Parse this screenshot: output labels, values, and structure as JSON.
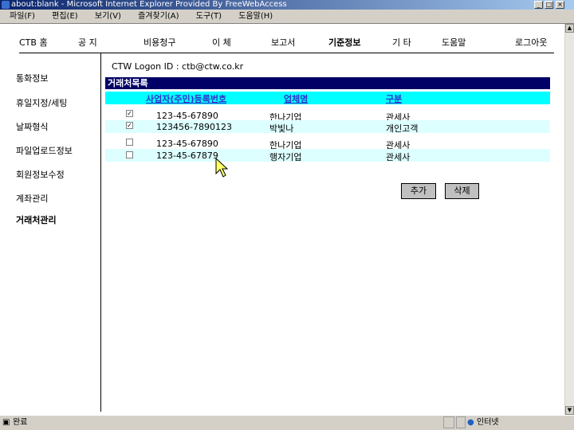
{
  "window": {
    "title": "about:blank - Microsoft Internet Explorer Provided By FreeWebAccess"
  },
  "menu": [
    "파일(F)",
    "편집(E)",
    "보기(V)",
    "즐겨찾기(A)",
    "도구(T)",
    "도움말(H)"
  ],
  "nav": [
    "CTB 홈",
    "공 지",
    "비용청구",
    "이 체",
    "보고서",
    "기준정보",
    "기 타",
    "도움말",
    "로그아웃"
  ],
  "sidebar": [
    "통화정보",
    "휴일지정/세팅",
    "날짜형식",
    "파일업로드정보",
    "회원정보수정",
    "계좌관리",
    "거래처관리"
  ],
  "logon": "CTW Logon ID : ctb@ctw.co.kr",
  "table": {
    "title": "거래처목록",
    "columns": [
      "사업자(주민)등록번호",
      "업체명",
      "구분"
    ],
    "rows": [
      {
        "checked": true,
        "id": "123-45-67890",
        "name": "한나기업",
        "type": "관세사"
      },
      {
        "checked": true,
        "id": "123456-7890123",
        "name": "박빛나",
        "type": "개인고객"
      },
      {
        "checked": false,
        "id": "123-45-67890",
        "name": "한나기업",
        "type": "관세사"
      },
      {
        "checked": false,
        "id": "123-45-67879",
        "name": "행자기업",
        "type": "관세사"
      }
    ]
  },
  "buttons": {
    "add": "추가",
    "delete": "삭제"
  },
  "status": {
    "text": "완료",
    "zone": "인터넷"
  },
  "colors": {
    "header": "#000066",
    "colhead": "#00ffff",
    "altrow": "#ddffff"
  }
}
